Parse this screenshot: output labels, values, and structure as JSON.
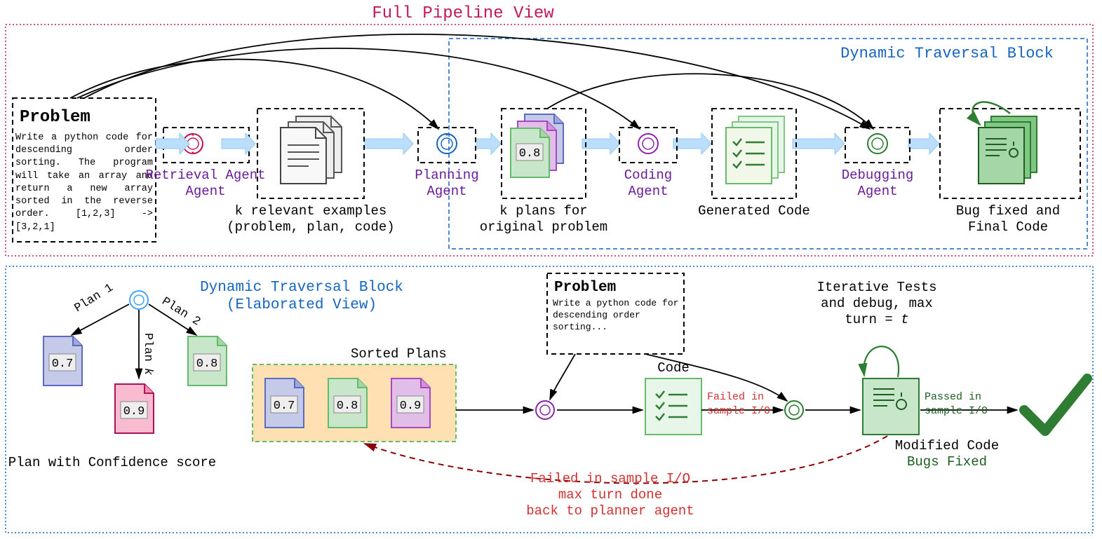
{
  "titles": {
    "pipeline": "Full Pipeline View",
    "dynamic_block": "Dynamic Traversal Block",
    "elaborated": "Dynamic Traversal Block",
    "elaborated2": "(Elaborated View)"
  },
  "problem": {
    "heading": "Problem",
    "body": "Write a python code for descending order sorting. The program will take an array and return a new array sorted in the reverse order. [1,2,3] -> [3,2,1]",
    "short": "Write a python code for descending order sorting..."
  },
  "agents": {
    "retrieval": "Retrieval Agent",
    "planning": "Planning Agent",
    "coding": "Coding Agent",
    "debugging": "Debugging Agent"
  },
  "captions": {
    "examples1": "k relevant examples",
    "examples2": "(problem, plan, code)",
    "plans1": "k plans for",
    "plans2": "original problem",
    "gencode": "Generated Code",
    "final1": "Bug fixed and",
    "final2": "Final Code",
    "plan_conf": "Plan with Confidence score",
    "sorted": "Sorted Plans",
    "code": "Code",
    "iter1": "Iterative Tests",
    "iter2": "and debug, max",
    "iter3": "turn = ",
    "iter3_var": "t",
    "mod1": "Modified Code",
    "mod2": "Bugs Fixed"
  },
  "plan_labels": {
    "p1": "Plan 1",
    "p2": "Plan 2",
    "pk": "Plan k"
  },
  "scores": {
    "top_plan": "0.8",
    "left_07": "0.7",
    "left_08": "0.8",
    "left_09": "0.9",
    "sorted_07": "0.7",
    "sorted_08": "0.8",
    "sorted_09": "0.9"
  },
  "flow_labels": {
    "failed": "Failed in",
    "failed2": "sample I/O",
    "passed": "Passed in",
    "passed2": "sample I/O",
    "back1": "Failed in sample I/O",
    "back2": "max turn done",
    "back3": "back to planner agent"
  },
  "colors": {
    "pink": "#c2185b",
    "blue": "#1565c0",
    "purple": "#6a1b9a",
    "maroon": "#8b0000",
    "green_text": "#1b5e20",
    "green": "#2e7d32",
    "red_text": "#d32f2f",
    "lightblue_arrow": "#bbdefb",
    "orange_bg": "#ffe0b2"
  }
}
